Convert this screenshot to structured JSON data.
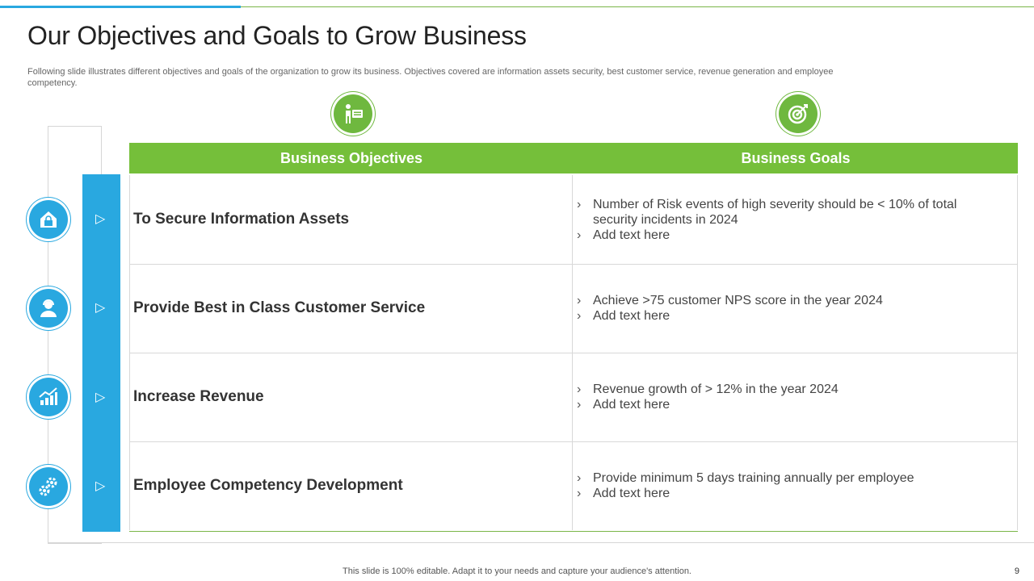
{
  "slide": {
    "title": "Our Objectives and Goals to Grow Business",
    "subtitle": "Following slide illustrates different objectives and goals of the organization to grow its business. Objectives covered are information assets security, best customer service, revenue generation and employee competency.",
    "footer": "This slide is 100% editable. Adapt it to your needs and capture your audience's attention.",
    "page_number": "9"
  },
  "colors": {
    "blue": "#29a8e0",
    "green": "#75bf3a",
    "text": "#333333"
  },
  "header_icons": {
    "objectives": "presenter-board-icon",
    "goals": "target-icon"
  },
  "table": {
    "headers": {
      "objectives": "Business Objectives",
      "goals": "Business Goals"
    },
    "rows": [
      {
        "icon": "secure-house-icon",
        "objective": "To Secure Information Assets",
        "goals": [
          "Number of Risk events of high severity should be < 10% of total security incidents in 2024",
          "Add text here"
        ]
      },
      {
        "icon": "customer-support-icon",
        "objective": "Provide Best in Class Customer Service",
        "goals": [
          "Achieve >75 customer NPS score in the year 2024",
          "Add text here"
        ]
      },
      {
        "icon": "growth-chart-icon",
        "objective": "Increase Revenue",
        "goals": [
          "Revenue growth of > 12% in the year 2024",
          "Add text here"
        ]
      },
      {
        "icon": "gears-icon",
        "objective": "Employee Competency Development",
        "goals": [
          "Provide minimum 5 days training annually per employee",
          "Add text here"
        ]
      }
    ]
  }
}
